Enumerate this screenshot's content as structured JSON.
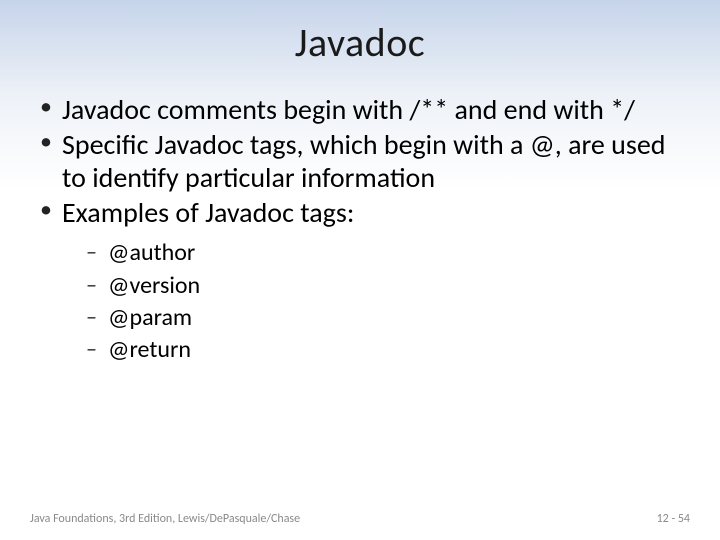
{
  "slide": {
    "title": "Javadoc",
    "bullets": [
      {
        "text": "Javadoc comments begin with /** and end with */"
      },
      {
        "text": "Specific Javadoc tags, which begin with a @, are used to identify particular information"
      },
      {
        "text": "Examples of Javadoc tags:"
      }
    ],
    "sub_bullets": [
      {
        "text": "@author"
      },
      {
        "text": "@version"
      },
      {
        "text": "@param"
      },
      {
        "text": "@return"
      }
    ],
    "footer_left": "Java Foundations, 3rd Edition, Lewis/DePasquale/Chase",
    "footer_right": "12 - 54"
  }
}
